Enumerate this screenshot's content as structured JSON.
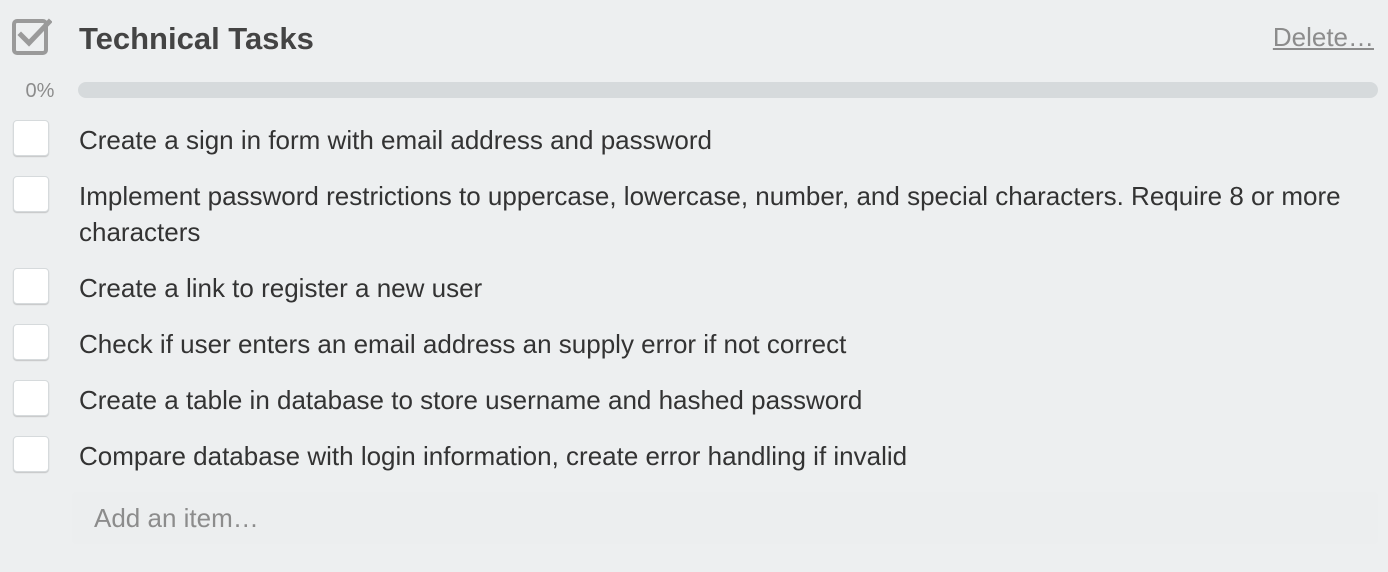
{
  "checklist": {
    "title": "Technical Tasks",
    "delete_label": "Delete…",
    "progress": {
      "label": "0%",
      "fraction": 0
    },
    "items": [
      {
        "text": "Create a sign in form with email address and password",
        "checked": false
      },
      {
        "text": "Implement password restrictions to uppercase, lowercase, number, and special characters. Require 8 or more characters",
        "checked": false
      },
      {
        "text": "Create a link to register a new user",
        "checked": false
      },
      {
        "text": "Check if user enters an email address an supply error if not correct",
        "checked": false
      },
      {
        "text": "Create a table in database to store username and hashed password",
        "checked": false
      },
      {
        "text": "Compare database with login information, create error handling if invalid",
        "checked": false
      }
    ],
    "add_item_placeholder": "Add an item…",
    "icons": {
      "header": "checklist-icon"
    },
    "colors": {
      "progress_track": "#d6dadc",
      "progress_fill": "#5aac44",
      "text": "#333333",
      "muted": "#8c8c8c"
    }
  }
}
